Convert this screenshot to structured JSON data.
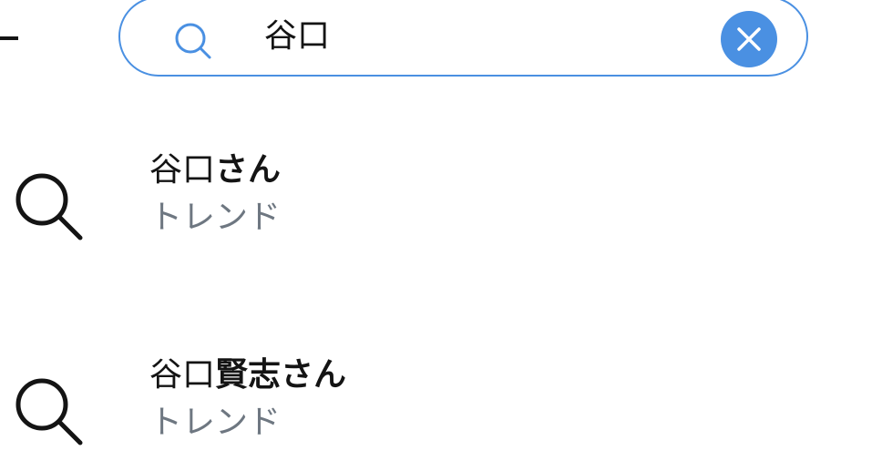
{
  "search": {
    "query": "谷口",
    "search_icon": "search-icon",
    "clear_icon": "close-icon",
    "accent_color": "#4a90e2"
  },
  "suggestions": [
    {
      "icon": "search-icon",
      "match": "谷口",
      "rest": "さん",
      "type": "トレンド"
    },
    {
      "icon": "search-icon",
      "match": "谷口",
      "rest": "賢志さん",
      "type": "トレンド"
    }
  ]
}
